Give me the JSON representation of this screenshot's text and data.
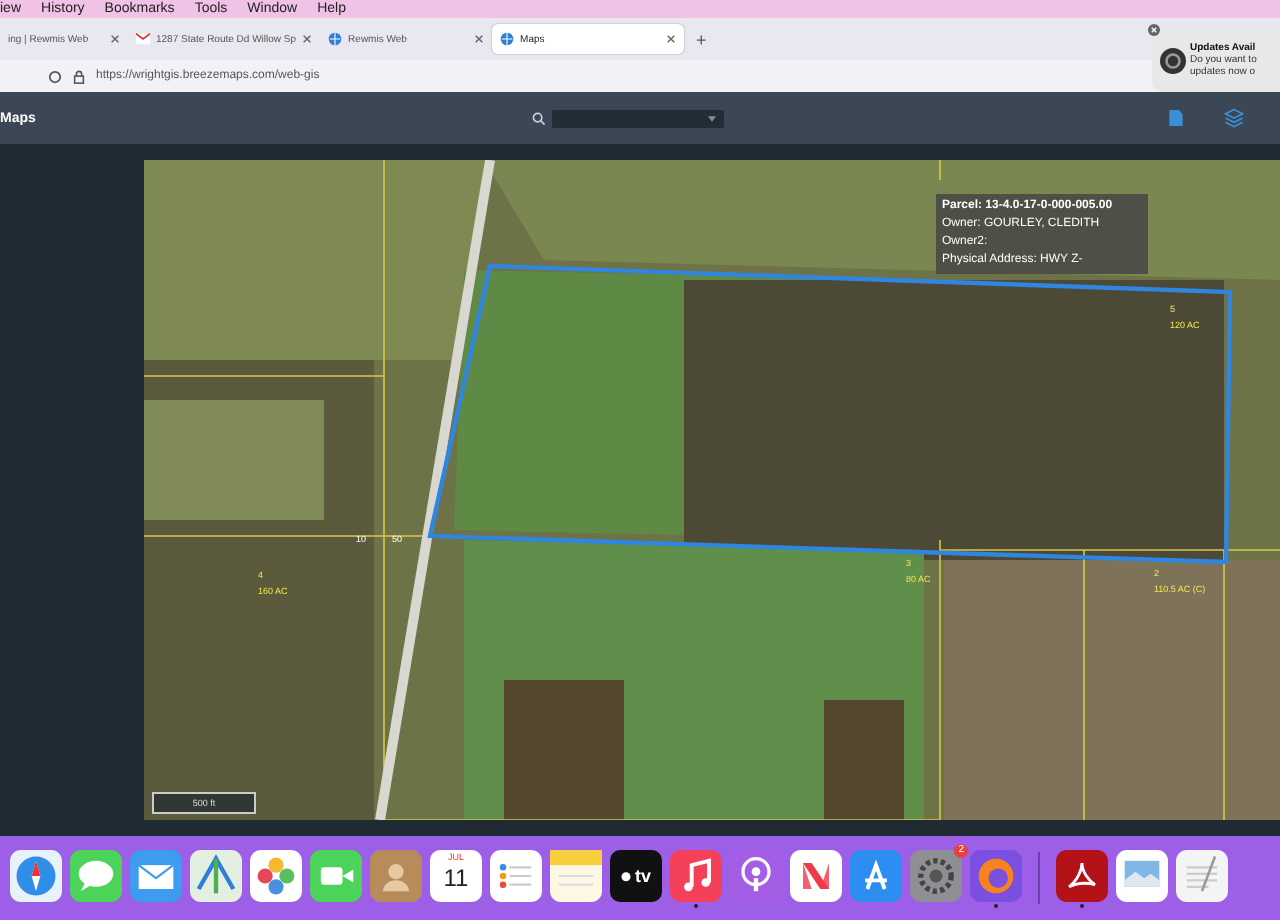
{
  "menu_bar": {
    "items": [
      "iew",
      "History",
      "Bookmarks",
      "Tools",
      "Window",
      "Help"
    ]
  },
  "tabs": [
    {
      "label": "ing | Rewmis Web",
      "kind": "plain",
      "selected": false
    },
    {
      "label": "1287 State Route Dd Willow Sp",
      "kind": "mail",
      "selected": false
    },
    {
      "label": "Rewmis Web",
      "kind": "site",
      "selected": false
    },
    {
      "label": "Maps",
      "kind": "site",
      "selected": true
    }
  ],
  "new_tab": "+",
  "address_bar": {
    "url": "https://wrightgis.breezemaps.com/web-gis"
  },
  "notification": {
    "title": "Updates Avail",
    "lines": [
      "Do you want to",
      "updates now o"
    ]
  },
  "app_header": {
    "title": "Maps"
  },
  "map": {
    "popup": [
      "Parcel: 13-4.0-17-0-000-005.00",
      "Owner: GOURLEY, CLEDITH",
      "Owner2:",
      "Physical Address: HWY Z-"
    ],
    "parcel_labels": [
      {
        "number": "5",
        "acreage": "120 AC"
      },
      {
        "number": "4",
        "acreage": "160 AC"
      },
      {
        "number": "3",
        "acreage": "80 AC"
      },
      {
        "number": "2",
        "acreage": "110.5 AC (C)"
      }
    ],
    "road_labels": [
      "10",
      "50"
    ],
    "scale": "500 ft"
  },
  "dock": {
    "apps": [
      {
        "kind": "compass",
        "running": false
      },
      {
        "kind": "chat",
        "running": false
      },
      {
        "kind": "mail",
        "running": false
      },
      {
        "kind": "maps",
        "running": false
      },
      {
        "kind": "photos",
        "running": false
      },
      {
        "kind": "video",
        "running": false
      },
      {
        "kind": "contacts",
        "running": false
      },
      {
        "kind": "calendar",
        "month": "JUL",
        "day": "11",
        "running": false
      },
      {
        "kind": "list",
        "running": false
      },
      {
        "kind": "notes",
        "running": false
      },
      {
        "kind": "tv",
        "text": "tv",
        "running": false
      },
      {
        "kind": "music",
        "running": true
      },
      {
        "kind": "podcast",
        "running": false
      },
      {
        "kind": "news",
        "running": false
      },
      {
        "kind": "store",
        "running": false
      },
      {
        "kind": "settings",
        "badge": "2",
        "running": false
      },
      {
        "kind": "fox",
        "running": true
      },
      {
        "kind": "pdf",
        "running": true
      },
      {
        "kind": "preview",
        "running": false
      },
      {
        "kind": "textedit",
        "running": false
      }
    ]
  }
}
